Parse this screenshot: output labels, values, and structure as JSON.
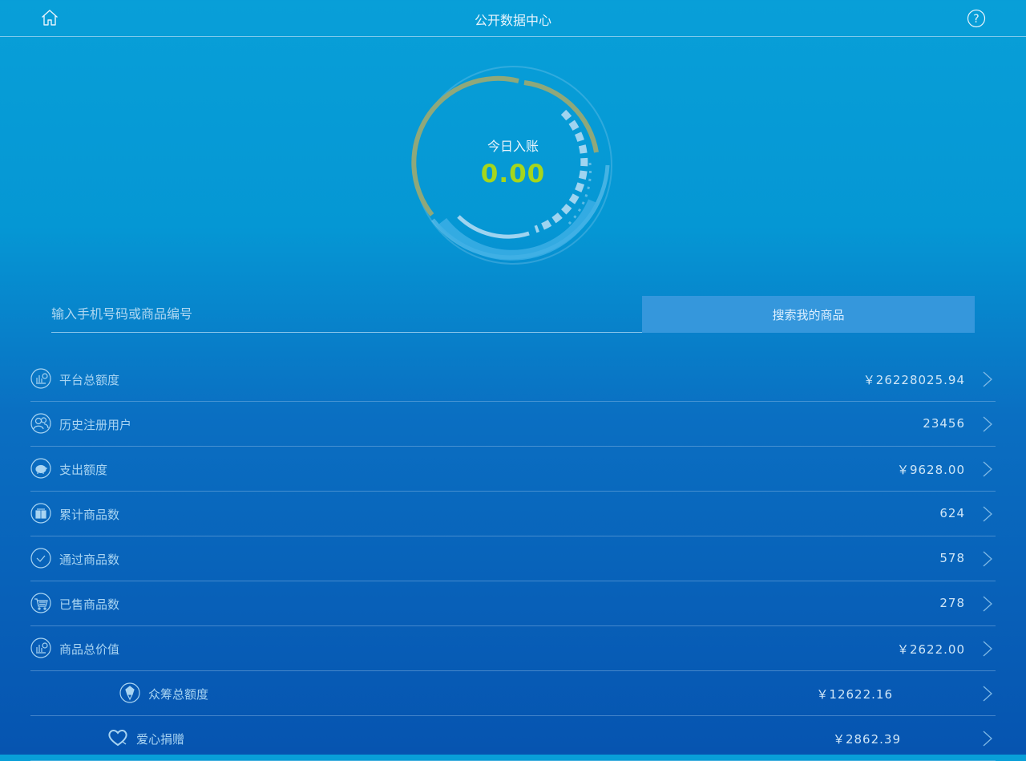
{
  "header": {
    "title": "公开数据中心",
    "home_icon": "home-icon",
    "help_icon": "help-icon"
  },
  "gauge": {
    "label": "今日入账",
    "value": "0.00"
  },
  "search": {
    "placeholder": "输入手机号码或商品编号",
    "value": "",
    "button_label": "搜索我的商品"
  },
  "stats": [
    {
      "label": "平台总额度",
      "value": "￥26228025.94",
      "icon": "chart-icon"
    },
    {
      "label": "历史注册用户",
      "value": "23456",
      "icon": "users-icon"
    },
    {
      "label": "支出额度",
      "value": "￥9628.00",
      "icon": "piggy-bank-icon"
    },
    {
      "label": "累计商品数",
      "value": "624",
      "icon": "gift-icon"
    },
    {
      "label": "通过商品数",
      "value": "578",
      "icon": "check-icon"
    },
    {
      "label": "已售商品数",
      "value": "278",
      "icon": "cart-icon"
    },
    {
      "label": "商品总价值",
      "value": "￥2622.00",
      "icon": "chart-icon"
    },
    {
      "label": "众筹总额度",
      "value": "￥12622.16",
      "icon": "crowdfund-icon"
    },
    {
      "label": "爱心捐赠",
      "value": "￥2862.39",
      "icon": "heart-icon"
    }
  ],
  "colors": {
    "accent": "#a6d61c",
    "button": "#3597dc",
    "background_top": "#089fd8",
    "background_bottom": "#0654b0"
  }
}
